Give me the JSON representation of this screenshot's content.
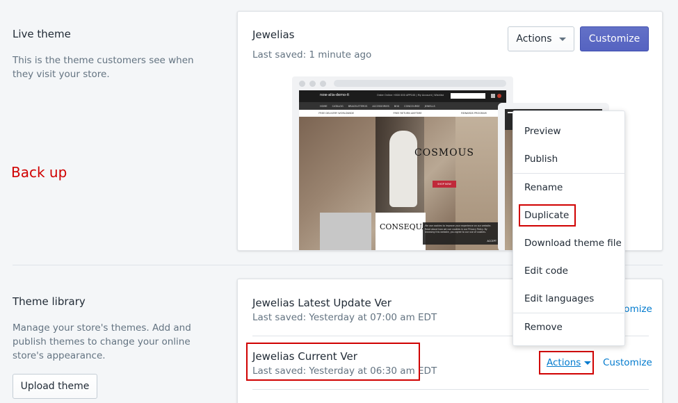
{
  "live_theme": {
    "section_title": "Live theme",
    "section_desc": "This is the theme customers see when they visit your store.",
    "theme_name": "Jewelias",
    "last_saved": "Last saved: 1 minute ago",
    "actions_label": "Actions",
    "customize_label": "Customize",
    "preview": {
      "logo_text": "now-alia-demo-it",
      "topbar_text": "Order Online +800 000 APP100  |  My Account  |  Wishlist",
      "nav_items": [
        "HOME",
        "CATALOG",
        "BRACELETEROS",
        "ACCESSORIES",
        "BOX",
        "CONCOURSE",
        "JEWELLS"
      ],
      "promo_items": [
        "FREE DELIVERY WORLDWIDE",
        "FREE RETURN ANYTIME",
        "REWARDS PROGRAM"
      ],
      "hero_title": "COSMOUS",
      "hero_button": "SHOP NOW",
      "card_title": "CONSEQUA",
      "cookie_text": "We use cookies to improve your experience on our website. Read about how we use cookies in our Privacy Policy. By browsing this website, you agree to our use of cookies.",
      "cookie_accept": "ACCEPT"
    }
  },
  "annotation": {
    "backup_label": "Back up"
  },
  "actions_menu": {
    "items": [
      {
        "label": "Preview"
      },
      {
        "label": "Publish"
      },
      {
        "label": "Rename"
      },
      {
        "label": "Duplicate"
      },
      {
        "label": "Download theme file"
      },
      {
        "label": "Edit code"
      },
      {
        "label": "Edit languages"
      },
      {
        "label": "Remove"
      }
    ]
  },
  "theme_library": {
    "section_title": "Theme library",
    "section_desc": "Manage your store's themes. Add and publish themes to change your online store's appearance.",
    "upload_label": "Upload theme",
    "themes": [
      {
        "name": "Jewelias Latest Update Ver",
        "last_saved": "Last saved: Yesterday at 07:00 am EDT",
        "customize_label": "Customize"
      },
      {
        "name": "Jewelias Current Ver",
        "last_saved": "Last saved: Yesterday at 06:30 am EDT",
        "actions_label": "Actions",
        "customize_label": "Customize"
      }
    ]
  },
  "colors": {
    "primary": "#5c6ac4",
    "link": "#007ace",
    "annotation": "#d00000",
    "background": "#f4f6f8"
  }
}
